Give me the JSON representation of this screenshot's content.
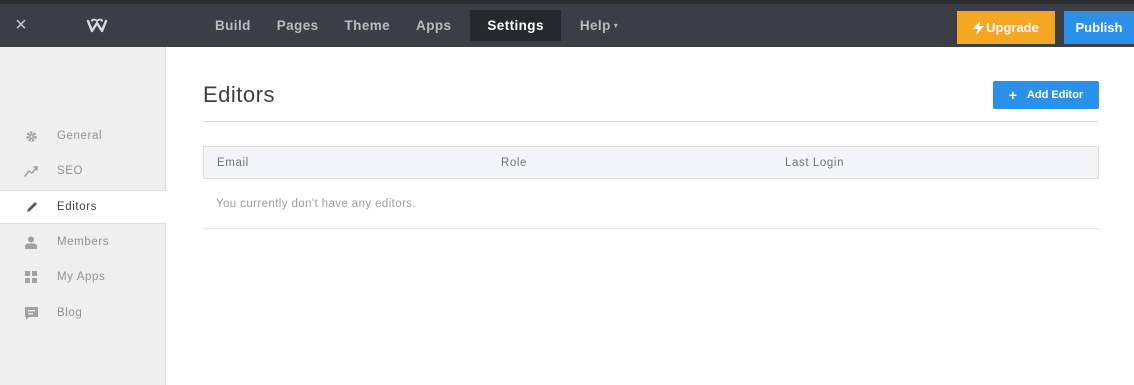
{
  "topbar": {
    "close_icon": "×",
    "logo_icon": "w-logo-icon",
    "nav": [
      {
        "label": "Build"
      },
      {
        "label": "Pages"
      },
      {
        "label": "Theme"
      },
      {
        "label": "Apps"
      },
      {
        "label": "Settings"
      },
      {
        "label": "Help"
      }
    ],
    "active_nav": "Settings",
    "help_caret": "▾",
    "upgrade_label": "Upgrade",
    "publish_label": "Publish",
    "colors": {
      "bar": "#3b3f45",
      "upgrade": "#f5a623",
      "publish": "#2a90e8"
    }
  },
  "sidebar": {
    "items": [
      {
        "label": "General",
        "icon": "gear-icon"
      },
      {
        "label": "SEO",
        "icon": "trend-icon"
      },
      {
        "label": "Editors",
        "icon": "pencil-icon"
      },
      {
        "label": "Members",
        "icon": "person-icon"
      },
      {
        "label": "My Apps",
        "icon": "grid-icon"
      },
      {
        "label": "Blog",
        "icon": "comment-icon"
      }
    ],
    "active_item": "Editors"
  },
  "main": {
    "title": "Editors",
    "add_button_plus": "+",
    "add_button_label": "Add Editor",
    "table": {
      "columns": [
        "Email",
        "Role",
        "Last Login"
      ],
      "empty_message": "You currently don't have any editors."
    }
  }
}
